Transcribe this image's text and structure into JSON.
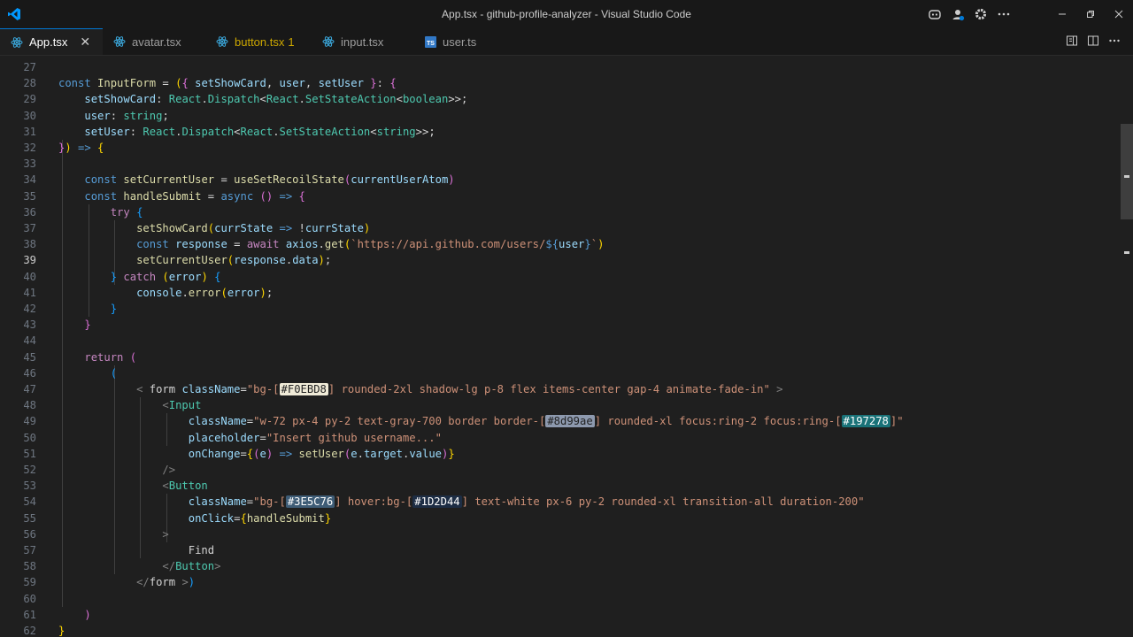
{
  "window": {
    "title": "App.tsx - github-profile-analyzer - Visual Studio Code"
  },
  "tabs": [
    {
      "label": "App.tsx",
      "active": true,
      "icon": "react-icon",
      "modified": ""
    },
    {
      "label": "avatar.tsx",
      "active": false,
      "icon": "react-icon",
      "modified": ""
    },
    {
      "label": "button.tsx",
      "active": false,
      "icon": "react-icon",
      "modified": "1"
    },
    {
      "label": "input.tsx",
      "active": false,
      "icon": "react-icon",
      "modified": ""
    },
    {
      "label": "user.ts",
      "active": false,
      "icon": "typescript-icon",
      "modified": ""
    }
  ],
  "colors": {
    "swatch_F0EBD8": "#F0EBD8",
    "swatch_8d99ae": "#8d99ae",
    "swatch_197278": "#197278",
    "swatch_3E5C76": "#3E5C76",
    "swatch_1D2D44": "#1D2D44"
  },
  "editor": {
    "current_line": "39",
    "lines": [
      {
        "n": "27",
        "t": []
      },
      {
        "n": "28",
        "t": [
          [
            "kw",
            "const "
          ],
          [
            "fn",
            "InputForm"
          ],
          [
            "pun",
            " = "
          ],
          [
            "br1",
            "("
          ],
          [
            "br2",
            "{ "
          ],
          [
            "var",
            "setShowCard"
          ],
          [
            "pun",
            ", "
          ],
          [
            "var",
            "user"
          ],
          [
            "pun",
            ", "
          ],
          [
            "var",
            "setUser"
          ],
          [
            "br2",
            " }"
          ],
          [
            "pun",
            ": "
          ],
          [
            "br2",
            "{"
          ]
        ]
      },
      {
        "n": "29",
        "t": [
          [
            "pun",
            "    "
          ],
          [
            "var",
            "setShowCard"
          ],
          [
            "pun",
            ": "
          ],
          [
            "typ",
            "React"
          ],
          [
            "pun",
            "."
          ],
          [
            "typ",
            "Dispatch"
          ],
          [
            "pun",
            "<"
          ],
          [
            "typ",
            "React"
          ],
          [
            "pun",
            "."
          ],
          [
            "typ",
            "SetStateAction"
          ],
          [
            "pun",
            "<"
          ],
          [
            "typ",
            "boolean"
          ],
          [
            "pun",
            ">>;"
          ]
        ]
      },
      {
        "n": "30",
        "t": [
          [
            "pun",
            "    "
          ],
          [
            "var",
            "user"
          ],
          [
            "pun",
            ": "
          ],
          [
            "typ",
            "string"
          ],
          [
            "pun",
            ";"
          ]
        ]
      },
      {
        "n": "31",
        "t": [
          [
            "pun",
            "    "
          ],
          [
            "var",
            "setUser"
          ],
          [
            "pun",
            ": "
          ],
          [
            "typ",
            "React"
          ],
          [
            "pun",
            "."
          ],
          [
            "typ",
            "Dispatch"
          ],
          [
            "pun",
            "<"
          ],
          [
            "typ",
            "React"
          ],
          [
            "pun",
            "."
          ],
          [
            "typ",
            "SetStateAction"
          ],
          [
            "pun",
            "<"
          ],
          [
            "typ",
            "string"
          ],
          [
            "pun",
            ">>;"
          ]
        ]
      },
      {
        "n": "32",
        "t": [
          [
            "br2",
            "}"
          ],
          [
            "br1",
            ")"
          ],
          [
            "kw",
            " =>"
          ],
          [
            "br1",
            " {"
          ]
        ]
      },
      {
        "n": "33",
        "t": []
      },
      {
        "n": "34",
        "t": [
          [
            "pun",
            "    "
          ],
          [
            "kw",
            "const "
          ],
          [
            "fn",
            "setCurrentUser"
          ],
          [
            "pun",
            " = "
          ],
          [
            "fn",
            "useSetRecoilState"
          ],
          [
            "br2",
            "("
          ],
          [
            "var",
            "currentUserAtom"
          ],
          [
            "br2",
            ")"
          ]
        ]
      },
      {
        "n": "35",
        "t": [
          [
            "pun",
            "    "
          ],
          [
            "kw",
            "const "
          ],
          [
            "fn",
            "handleSubmit"
          ],
          [
            "pun",
            " = "
          ],
          [
            "kw",
            "async "
          ],
          [
            "br2",
            "()"
          ],
          [
            "kw",
            " =>"
          ],
          [
            "br2",
            " {"
          ]
        ]
      },
      {
        "n": "36",
        "t": [
          [
            "pun",
            "        "
          ],
          [
            "ctl",
            "try "
          ],
          [
            "br3",
            "{"
          ]
        ]
      },
      {
        "n": "37",
        "t": [
          [
            "pun",
            "            "
          ],
          [
            "fn",
            "setShowCard"
          ],
          [
            "br1",
            "("
          ],
          [
            "var",
            "currState"
          ],
          [
            "kw",
            " => "
          ],
          [
            "pun",
            "!"
          ],
          [
            "var",
            "currState"
          ],
          [
            "br1",
            ")"
          ]
        ]
      },
      {
        "n": "38",
        "t": [
          [
            "pun",
            "            "
          ],
          [
            "kw",
            "const "
          ],
          [
            "var",
            "response"
          ],
          [
            "pun",
            " = "
          ],
          [
            "ctl",
            "await "
          ],
          [
            "var",
            "axios"
          ],
          [
            "pun",
            "."
          ],
          [
            "fn",
            "get"
          ],
          [
            "br1",
            "("
          ],
          [
            "str",
            "`https://api.github.com/users/"
          ],
          [
            "kw",
            "${"
          ],
          [
            "var",
            "user"
          ],
          [
            "kw",
            "}"
          ],
          [
            "str",
            "`"
          ],
          [
            "br1",
            ")"
          ]
        ]
      },
      {
        "n": "39",
        "t": [
          [
            "pun",
            "            "
          ],
          [
            "fn",
            "setCurrentUser"
          ],
          [
            "br1",
            "("
          ],
          [
            "var",
            "response"
          ],
          [
            "pun",
            "."
          ],
          [
            "var",
            "data"
          ],
          [
            "br1",
            ")"
          ],
          [
            "pun",
            ";"
          ]
        ]
      },
      {
        "n": "40",
        "t": [
          [
            "pun",
            "        "
          ],
          [
            "br3",
            "}"
          ],
          [
            "ctl",
            " catch "
          ],
          [
            "br1",
            "("
          ],
          [
            "var",
            "error"
          ],
          [
            "br1",
            ")"
          ],
          [
            "br3",
            " {"
          ]
        ]
      },
      {
        "n": "41",
        "t": [
          [
            "pun",
            "            "
          ],
          [
            "var",
            "console"
          ],
          [
            "pun",
            "."
          ],
          [
            "fn",
            "error"
          ],
          [
            "br1",
            "("
          ],
          [
            "var",
            "error"
          ],
          [
            "br1",
            ")"
          ],
          [
            "pun",
            ";"
          ]
        ]
      },
      {
        "n": "42",
        "t": [
          [
            "pun",
            "        "
          ],
          [
            "br3",
            "}"
          ]
        ]
      },
      {
        "n": "43",
        "t": [
          [
            "pun",
            "    "
          ],
          [
            "br2",
            "}"
          ]
        ]
      },
      {
        "n": "44",
        "t": []
      },
      {
        "n": "45",
        "t": [
          [
            "pun",
            "    "
          ],
          [
            "ctl",
            "return "
          ],
          [
            "br2",
            "("
          ]
        ]
      },
      {
        "n": "46",
        "t": [
          [
            "pun",
            "        "
          ],
          [
            "br3",
            "("
          ]
        ]
      },
      {
        "n": "47",
        "t": [
          [
            "pun",
            "            "
          ],
          [
            "tagd",
            "< "
          ],
          [
            "plain",
            "form "
          ],
          [
            "attr",
            "className"
          ],
          [
            "pun",
            "="
          ],
          [
            "str",
            "\"bg-["
          ],
          [
            "sw1",
            "#F0EBD8"
          ],
          [
            "str",
            "] rounded-2xl shadow-lg p-8 flex items-center gap-4 animate-fade-in\""
          ],
          [
            "tagd",
            " >"
          ]
        ]
      },
      {
        "n": "48",
        "t": [
          [
            "pun",
            "                "
          ],
          [
            "tagd",
            "<"
          ],
          [
            "tag",
            "Input"
          ]
        ]
      },
      {
        "n": "49",
        "t": [
          [
            "pun",
            "                    "
          ],
          [
            "attr",
            "className"
          ],
          [
            "pun",
            "="
          ],
          [
            "str",
            "\"w-72 px-4 py-2 text-gray-700 border border-["
          ],
          [
            "sw2",
            "#8d99ae"
          ],
          [
            "str",
            "] rounded-xl focus:ring-2 focus:ring-["
          ],
          [
            "sw3",
            "#197278"
          ],
          [
            "str",
            "]\""
          ]
        ]
      },
      {
        "n": "50",
        "t": [
          [
            "pun",
            "                    "
          ],
          [
            "attr",
            "placeholder"
          ],
          [
            "pun",
            "="
          ],
          [
            "str",
            "\"Insert github username...\""
          ]
        ]
      },
      {
        "n": "51",
        "t": [
          [
            "pun",
            "                    "
          ],
          [
            "attr",
            "onChange"
          ],
          [
            "pun",
            "="
          ],
          [
            "br1",
            "{"
          ],
          [
            "br2",
            "("
          ],
          [
            "var",
            "e"
          ],
          [
            "br2",
            ")"
          ],
          [
            "kw",
            " => "
          ],
          [
            "fn",
            "setUser"
          ],
          [
            "br2",
            "("
          ],
          [
            "var",
            "e"
          ],
          [
            "pun",
            "."
          ],
          [
            "var",
            "target"
          ],
          [
            "pun",
            "."
          ],
          [
            "var",
            "value"
          ],
          [
            "br2",
            ")"
          ],
          [
            "br1",
            "}"
          ]
        ]
      },
      {
        "n": "52",
        "t": [
          [
            "pun",
            "                "
          ],
          [
            "tagd",
            "/>"
          ]
        ]
      },
      {
        "n": "53",
        "t": [
          [
            "pun",
            "                "
          ],
          [
            "tagd",
            "<"
          ],
          [
            "tag",
            "Button"
          ]
        ]
      },
      {
        "n": "54",
        "t": [
          [
            "pun",
            "                    "
          ],
          [
            "attr",
            "className"
          ],
          [
            "pun",
            "="
          ],
          [
            "str",
            "\"bg-["
          ],
          [
            "sw4",
            "#3E5C76"
          ],
          [
            "str",
            "] hover:bg-["
          ],
          [
            "sw5",
            "#1D2D44"
          ],
          [
            "str",
            "] text-white px-6 py-2 rounded-xl transition-all duration-200\""
          ]
        ]
      },
      {
        "n": "55",
        "t": [
          [
            "pun",
            "                    "
          ],
          [
            "attr",
            "onClick"
          ],
          [
            "pun",
            "="
          ],
          [
            "br1",
            "{"
          ],
          [
            "fn",
            "handleSubmit"
          ],
          [
            "br1",
            "}"
          ]
        ]
      },
      {
        "n": "56",
        "t": [
          [
            "pun",
            "                "
          ],
          [
            "tagd",
            ">"
          ]
        ]
      },
      {
        "n": "57",
        "t": [
          [
            "pun",
            "                    "
          ],
          [
            "plain",
            "Find"
          ]
        ]
      },
      {
        "n": "58",
        "t": [
          [
            "pun",
            "                "
          ],
          [
            "tagd",
            "</"
          ],
          [
            "tag",
            "Button"
          ],
          [
            "tagd",
            ">"
          ]
        ]
      },
      {
        "n": "59",
        "t": [
          [
            "pun",
            "            "
          ],
          [
            "tagd",
            "</"
          ],
          [
            "plain",
            "form "
          ],
          [
            "tagd",
            ">"
          ],
          [
            "br3",
            ")"
          ]
        ]
      },
      {
        "n": "60",
        "t": []
      },
      {
        "n": "61",
        "t": [
          [
            "pun",
            "    "
          ],
          [
            "br2",
            ")"
          ]
        ]
      },
      {
        "n": "62",
        "t": [
          [
            "br1",
            "}"
          ]
        ]
      }
    ]
  }
}
